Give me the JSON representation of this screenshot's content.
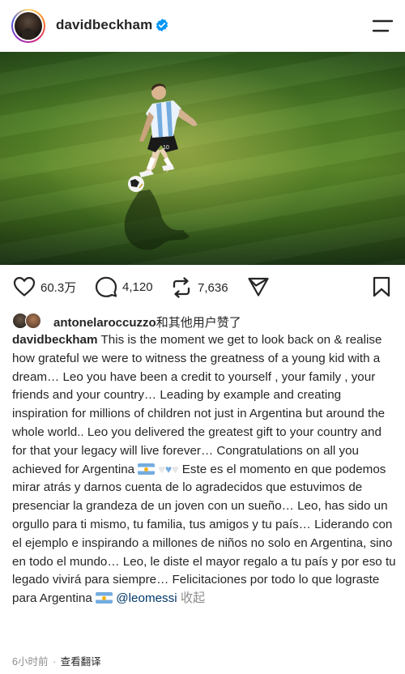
{
  "header": {
    "username": "davidbeckham",
    "verified": true,
    "avatar_icon": "profile-photo",
    "menu_icon": "hamburger-menu-icon"
  },
  "post": {
    "photo_alt": "football-player-dribbling-photo"
  },
  "actions": {
    "likes_count": "60.3万",
    "comments_count": "4,120",
    "reposts_count": "7,636",
    "icons": [
      "heart-icon",
      "comment-icon",
      "repost-icon",
      "share-icon",
      "bookmark-icon"
    ]
  },
  "liked_by": {
    "user": "antonelaroccuzzo",
    "suffix": "和其他用户赞了"
  },
  "caption": {
    "user": "davidbeckham",
    "text_en": "This is the moment we get to look back on & realise how grateful we were to witness the greatness of a young kid with a dream… Leo you have been a credit to yourself , your family , your friends and your country… Leading by example and creating inspiration for millions of children not just in Argentina but around the whole world.. Leo you delivered the greatest gift to your country and for that your legacy will live forever… Congratulations on all you achieved for Argentina",
    "text_es": "Este es el momento en que podemos mirar atrás y darnos cuenta de lo agradecidos que estuvimos de presenciar la grandeza de un joven con un sueño… Leo, has sido un orgullo para ti mismo, tu familia, tus amigos y tu país… Liderando con el ejemplo e inspirando a millones de niños no solo en Argentina, sino en todo el mundo… Leo, le diste el mayor regalo a tu país y por eso tu legado vivirá para siempre… Felicitaciones por todo lo que lograste para Argentina",
    "mention": "@leomessi",
    "collapse_label": "收起"
  },
  "footer": {
    "time": "6小时前",
    "separator": "·",
    "translate_label": "查看翻译"
  },
  "colors": {
    "link": "#00376b",
    "muted": "#8e8e8e",
    "verified": "#0095f6",
    "text": "#262626"
  }
}
